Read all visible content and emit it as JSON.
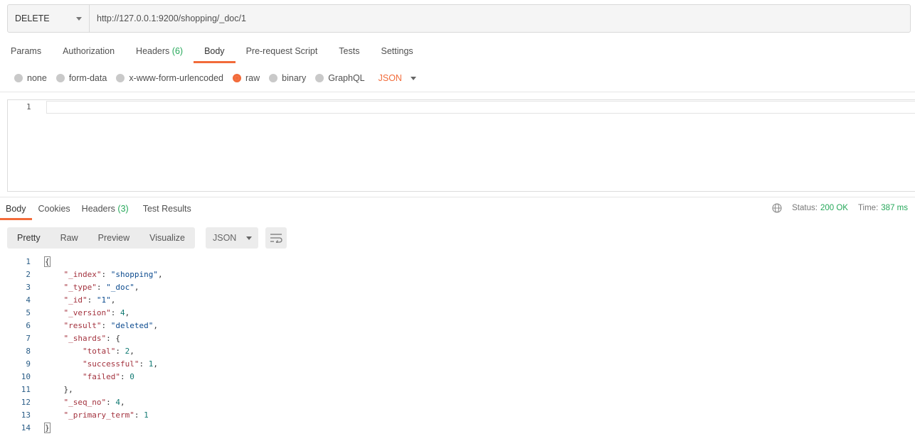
{
  "request": {
    "method": "DELETE",
    "url": "http://127.0.0.1:9200/shopping/_doc/1"
  },
  "request_tabs": [
    {
      "label": "Params",
      "count": ""
    },
    {
      "label": "Authorization",
      "count": ""
    },
    {
      "label": "Headers",
      "count": "(6)"
    },
    {
      "label": "Body",
      "count": "",
      "active": true
    },
    {
      "label": "Pre-request Script",
      "count": ""
    },
    {
      "label": "Tests",
      "count": ""
    },
    {
      "label": "Settings",
      "count": ""
    }
  ],
  "body_types": [
    {
      "label": "none",
      "selected": false
    },
    {
      "label": "form-data",
      "selected": false
    },
    {
      "label": "x-www-form-urlencoded",
      "selected": false
    },
    {
      "label": "raw",
      "selected": true
    },
    {
      "label": "binary",
      "selected": false
    },
    {
      "label": "GraphQL",
      "selected": false
    }
  ],
  "raw_format": "JSON",
  "request_editor": {
    "line_number": "1"
  },
  "response_tabs": [
    {
      "label": "Body",
      "count": "",
      "active": true
    },
    {
      "label": "Cookies",
      "count": ""
    },
    {
      "label": "Headers",
      "count": "(3)"
    },
    {
      "label": "Test Results",
      "count": ""
    }
  ],
  "status": {
    "status_label": "Status:",
    "status_value": "200 OK",
    "time_label": "Time:",
    "time_value": "387 ms"
  },
  "view_modes": [
    "Pretty",
    "Raw",
    "Preview",
    "Visualize"
  ],
  "response_format": "JSON",
  "colors": {
    "accent": "#f26b3a",
    "success": "#26a85a"
  },
  "response_lines": [
    {
      "n": "1",
      "indent": 0,
      "parts": [
        [
          "p",
          "{"
        ]
      ]
    },
    {
      "n": "2",
      "indent": 1,
      "parts": [
        [
          "k",
          "\"_index\""
        ],
        [
          "p",
          ": "
        ],
        [
          "s",
          "\"shopping\""
        ],
        [
          "p",
          ","
        ]
      ]
    },
    {
      "n": "3",
      "indent": 1,
      "parts": [
        [
          "k",
          "\"_type\""
        ],
        [
          "p",
          ": "
        ],
        [
          "s",
          "\"_doc\""
        ],
        [
          "p",
          ","
        ]
      ]
    },
    {
      "n": "4",
      "indent": 1,
      "parts": [
        [
          "k",
          "\"_id\""
        ],
        [
          "p",
          ": "
        ],
        [
          "s",
          "\"1\""
        ],
        [
          "p",
          ","
        ]
      ]
    },
    {
      "n": "5",
      "indent": 1,
      "parts": [
        [
          "k",
          "\"_version\""
        ],
        [
          "p",
          ": "
        ],
        [
          "n",
          "4"
        ],
        [
          "p",
          ","
        ]
      ]
    },
    {
      "n": "6",
      "indent": 1,
      "parts": [
        [
          "k",
          "\"result\""
        ],
        [
          "p",
          ": "
        ],
        [
          "s",
          "\"deleted\""
        ],
        [
          "p",
          ","
        ]
      ]
    },
    {
      "n": "7",
      "indent": 1,
      "parts": [
        [
          "k",
          "\"_shards\""
        ],
        [
          "p",
          ": {"
        ]
      ]
    },
    {
      "n": "8",
      "indent": 2,
      "parts": [
        [
          "k",
          "\"total\""
        ],
        [
          "p",
          ": "
        ],
        [
          "n",
          "2"
        ],
        [
          "p",
          ","
        ]
      ]
    },
    {
      "n": "9",
      "indent": 2,
      "parts": [
        [
          "k",
          "\"successful\""
        ],
        [
          "p",
          ": "
        ],
        [
          "n",
          "1"
        ],
        [
          "p",
          ","
        ]
      ]
    },
    {
      "n": "10",
      "indent": 2,
      "parts": [
        [
          "k",
          "\"failed\""
        ],
        [
          "p",
          ": "
        ],
        [
          "n",
          "0"
        ]
      ]
    },
    {
      "n": "11",
      "indent": 1,
      "parts": [
        [
          "p",
          "},"
        ]
      ]
    },
    {
      "n": "12",
      "indent": 1,
      "parts": [
        [
          "k",
          "\"_seq_no\""
        ],
        [
          "p",
          ": "
        ],
        [
          "n",
          "4"
        ],
        [
          "p",
          ","
        ]
      ]
    },
    {
      "n": "13",
      "indent": 1,
      "parts": [
        [
          "k",
          "\"_primary_term\""
        ],
        [
          "p",
          ": "
        ],
        [
          "n",
          "1"
        ]
      ]
    },
    {
      "n": "14",
      "indent": 0,
      "parts": [
        [
          "p",
          "}"
        ]
      ]
    }
  ]
}
